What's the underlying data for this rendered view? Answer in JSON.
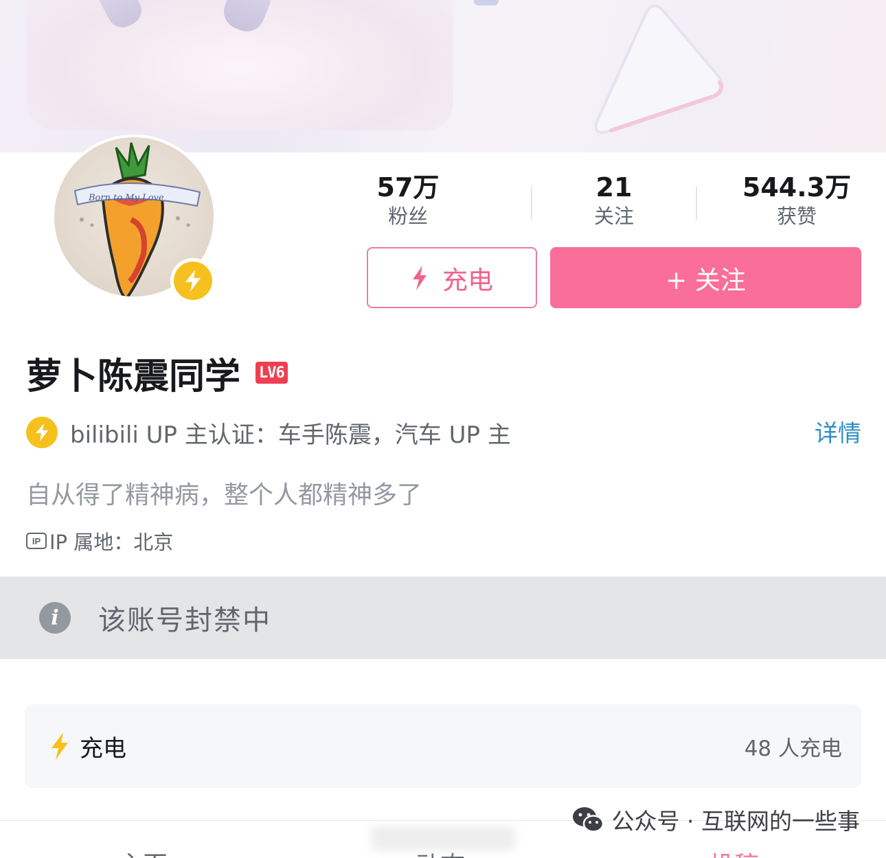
{
  "profile": {
    "name": "萝卜陈震同学",
    "level_badge": "LV6",
    "certification": "bilibili UP 主认证：车手陈震，汽车 UP 主",
    "detail_link": "详情",
    "bio": "自从得了精神病，整个人都精神多了",
    "ip_location": "IP 属地：北京",
    "ip_icon_label": "IP"
  },
  "stats": [
    {
      "value": "57万",
      "label": "粉丝"
    },
    {
      "value": "21",
      "label": "关注"
    },
    {
      "value": "544.3万",
      "label": "获赞"
    }
  ],
  "actions": {
    "charge_label": "充电",
    "follow_label": "+ 关注"
  },
  "ban_notice": {
    "icon_glyph": "i",
    "text": "该账号封禁中"
  },
  "charge_card": {
    "title": "充电",
    "count": "48 人充电"
  },
  "tabs": [
    {
      "label": "主页"
    },
    {
      "label": "动态"
    },
    {
      "label": "投稿"
    }
  ],
  "watermark": {
    "text": "公众号 · 互联网的一些事"
  },
  "colors": {
    "brand_pink": "#fb7299",
    "follow_button": "#fa6f99",
    "charge_border": "#f17a9d",
    "verify_yellow": "#f6c11f",
    "level_red": "#f03e51",
    "link_blue": "#2f8fc7"
  },
  "icons": [
    "lightning-icon",
    "verified-badge-icon",
    "info-icon",
    "ip-icon",
    "wechat-icon"
  ]
}
